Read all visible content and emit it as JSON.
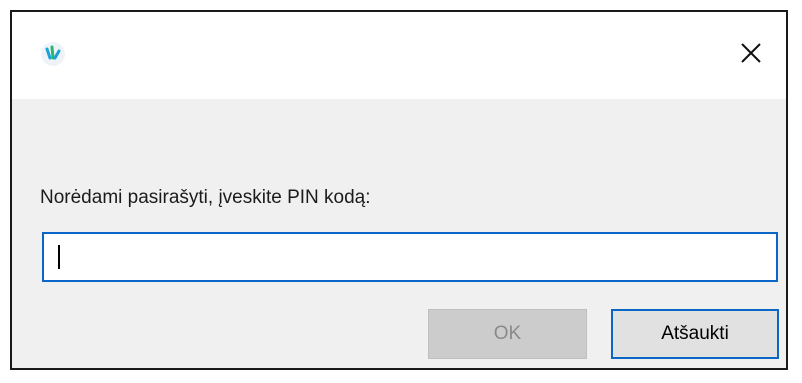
{
  "dialog": {
    "icon": "app-logo-icon",
    "close_icon": "close-icon",
    "prompt_label": "Norėdami pasirašyti, įveskite PIN kodą:",
    "pin_value": "",
    "ok_label": "OK",
    "ok_enabled": false,
    "cancel_label": "Atšaukti",
    "colors": {
      "focus_border": "#0a67c7",
      "client_bg": "#f0f0f0",
      "disabled_text": "#8a8a8a"
    }
  }
}
